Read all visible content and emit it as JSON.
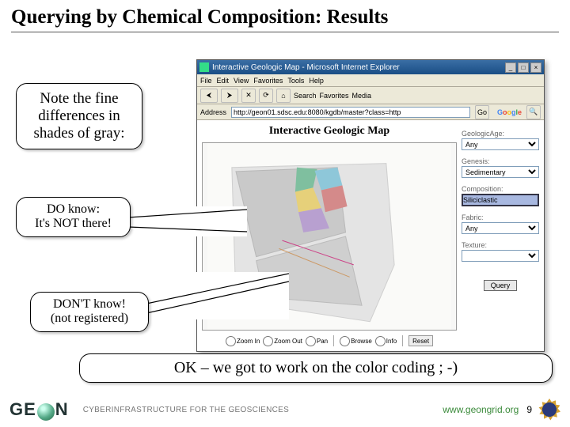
{
  "slide": {
    "title": "Querying by Chemical Composition: Results",
    "note_callout": "Note the fine differences in shades of gray:",
    "doknow_callout_l1": "DO know:",
    "doknow_callout_l2": "It's NOT there!",
    "dontknow_callout_l1": "DON'T know!",
    "dontknow_callout_l2": "(not registered)",
    "bottom_callout": "OK – we got to work on the color coding ; -)"
  },
  "browser": {
    "window_title": "Interactive Geologic Map - Microsoft Internet Explorer",
    "menubar": [
      "File",
      "Edit",
      "View",
      "Favorites",
      "Tools",
      "Help"
    ],
    "toolbar_labels": {
      "back": "⮜",
      "fwd": "⮞",
      "stop": "✕",
      "refresh": "⟳",
      "home": "⌂",
      "search": "Search",
      "favorites": "Favorites",
      "media": "Media"
    },
    "address_label": "Address",
    "address_value": "http://geon01.sdsc.edu:8080/kgdb/master?class=http",
    "go_label": "Go",
    "google_label": "Google",
    "page_title": "Interactive Geologic Map",
    "fields": {
      "geologic_age": {
        "label": "GeologicAge:",
        "value": "Any"
      },
      "genesis": {
        "label": "Genesis:",
        "value": "Sedimentary"
      },
      "composition": {
        "label": "Composition:",
        "value": "Siliciclastic"
      },
      "fabric": {
        "label": "Fabric:",
        "value": "Any"
      },
      "texture": {
        "label": "Texture:",
        "value": ""
      }
    },
    "query_button": "Query",
    "map_tools": {
      "zoom_in": "Zoom In",
      "zoom_out": "Zoom Out",
      "pan": "Pan",
      "browse": "Browse",
      "info": "Info",
      "reset": "Reset"
    }
  },
  "footer": {
    "logo_text_pre": "GE",
    "logo_text_post": "N",
    "tagline": "CYBERINFRASTRUCTURE FOR THE GEOSCIENCES",
    "url": "www.geongrid.org",
    "page_number": "9"
  }
}
